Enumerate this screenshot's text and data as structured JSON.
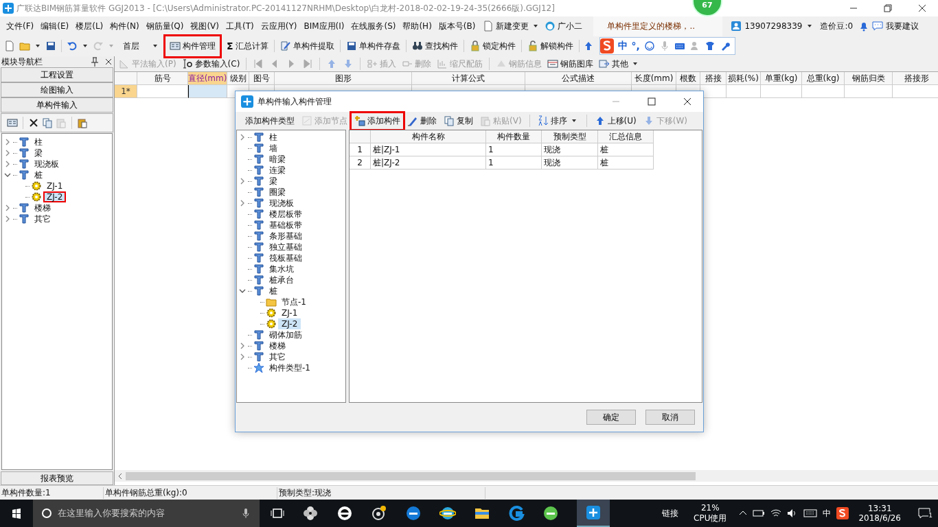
{
  "window": {
    "title": "广联达BIM钢筋算量软件 GGJ2013 - [C:\\Users\\Administrator.PC-20141127NRHM\\Desktop\\白龙村-2018-02-02-19-24-35(2666版).GGJ12]"
  },
  "floating_badge": "67",
  "menu": [
    "文件(F)",
    "编辑(E)",
    "楼层(L)",
    "构件(N)",
    "钢筋量(Q)",
    "视图(V)",
    "工具(T)",
    "云应用(Y)",
    "BIM应用(I)",
    "在线服务(S)",
    "帮助(H)",
    "版本号(B)"
  ],
  "menu_extras": [
    {
      "label": "新建变更",
      "kind": "dropdown"
    },
    {
      "label": "广小二",
      "kind": "plain"
    }
  ],
  "notice": "单构件里定义的楼梯，..",
  "account": {
    "user": "13907298339",
    "beans": "造价豆:0",
    "suggest": "我要建议"
  },
  "quick_buttons": [
    {
      "disabled": false
    },
    {
      "disabled": false
    },
    {
      "disabled": false
    },
    {
      "disabled": false
    },
    {
      "disabled": true
    }
  ],
  "floor": "首层",
  "toolbar": [
    {
      "label": "构件管理",
      "highlighted": true
    },
    {
      "label": "汇总计算",
      "glyph": "Σ"
    },
    {
      "label": "单构件提取"
    },
    {
      "label": "单构件存盘"
    },
    {
      "label": "查找构件"
    },
    {
      "label": "锁定构件"
    },
    {
      "label": "解锁构件"
    }
  ],
  "ime_bar": {
    "mode": "中",
    "punct": "°,"
  },
  "nav_panel": {
    "title": "模块导航栏",
    "modules": [
      "工程设置",
      "绘图输入",
      "单构件输入"
    ],
    "footer": "报表预览",
    "tree": [
      {
        "label": "柱",
        "kind": "category",
        "expanded": false,
        "selected": false
      },
      {
        "label": "梁",
        "kind": "category",
        "expanded": false,
        "selected": false
      },
      {
        "label": "现浇板",
        "kind": "category",
        "expanded": false,
        "selected": false
      },
      {
        "label": "桩",
        "kind": "category",
        "expanded": true,
        "selected": false,
        "children": [
          {
            "label": "ZJ-1",
            "kind": "component",
            "selected": false
          },
          {
            "label": "ZJ-2",
            "kind": "component",
            "selected": true,
            "highlighted": true
          }
        ]
      },
      {
        "label": "楼梯",
        "kind": "category",
        "expanded": false,
        "selected": false
      },
      {
        "label": "其它",
        "kind": "category",
        "expanded": false,
        "selected": false
      }
    ]
  },
  "grid_toolbar": [
    {
      "kind": "button",
      "label": "平法输入(P)",
      "disabled": true
    },
    {
      "kind": "button",
      "label": "参数输入(C)",
      "disabled": false
    },
    {
      "kind": "icon",
      "disabled": true
    },
    {
      "kind": "icon",
      "disabled": true
    },
    {
      "kind": "icon",
      "disabled": true
    },
    {
      "kind": "icon",
      "disabled": true
    },
    {
      "kind": "icon",
      "disabled": true
    },
    {
      "kind": "icon",
      "disabled": true
    },
    {
      "kind": "button",
      "label": "插入",
      "disabled": true
    },
    {
      "kind": "button",
      "label": "删除",
      "disabled": true
    },
    {
      "kind": "button",
      "label": "缩尺配筋",
      "disabled": true
    },
    {
      "kind": "button",
      "label": "钢筋信息",
      "disabled": true
    },
    {
      "kind": "button",
      "label": "钢筋图库",
      "disabled": false
    },
    {
      "kind": "dropdown",
      "label": "其他",
      "disabled": false
    }
  ],
  "grid": {
    "columns": [
      {
        "label": "筋号",
        "selected": false
      },
      {
        "label": "直径(mm)",
        "selected": true
      },
      {
        "label": "级别",
        "selected": false
      },
      {
        "label": "图号",
        "selected": false
      },
      {
        "label": "图形",
        "selected": false
      },
      {
        "label": "计算公式",
        "selected": false
      },
      {
        "label": "公式描述",
        "selected": false
      },
      {
        "label": "长度(mm)",
        "selected": false
      },
      {
        "label": "根数",
        "selected": false
      },
      {
        "label": "搭接",
        "selected": false
      },
      {
        "label": "损耗(%)",
        "selected": false
      },
      {
        "label": "单重(kg)",
        "selected": false
      },
      {
        "label": "总重(kg)",
        "selected": false
      },
      {
        "label": "钢筋归类",
        "selected": false
      },
      {
        "label": "搭接形",
        "selected": false
      }
    ],
    "rows": [
      {
        "header": "1*"
      }
    ]
  },
  "dialog": {
    "title": "单构件输入构件管理",
    "toolbar": [
      {
        "label": "添加构件类型",
        "disabled": false
      },
      {
        "label": "添加节点",
        "disabled": true
      },
      {
        "label": "添加构件",
        "disabled": false,
        "highlighted": true
      },
      {
        "label": "删除",
        "disabled": false
      },
      {
        "label": "复制",
        "disabled": false
      },
      {
        "label": "粘贴(V)",
        "disabled": true
      },
      {
        "label": "排序",
        "disabled": false,
        "kind": "dropdown"
      },
      {
        "label": "上移(U)",
        "disabled": false
      },
      {
        "label": "下移(W)",
        "disabled": true
      }
    ],
    "tree": [
      {
        "label": "柱",
        "kind": "category",
        "expanded": false,
        "selected": false
      },
      {
        "label": "墙",
        "kind": "category",
        "selected": false
      },
      {
        "label": "暗梁",
        "kind": "category",
        "selected": false
      },
      {
        "label": "连梁",
        "kind": "category",
        "selected": false
      },
      {
        "label": "梁",
        "kind": "category",
        "expanded": false,
        "selected": false
      },
      {
        "label": "圈梁",
        "kind": "category",
        "selected": false
      },
      {
        "label": "现浇板",
        "kind": "category",
        "expanded": false,
        "selected": false
      },
      {
        "label": "楼层板带",
        "kind": "category",
        "selected": false
      },
      {
        "label": "基础板带",
        "kind": "category",
        "selected": false
      },
      {
        "label": "条形基础",
        "kind": "category",
        "selected": false
      },
      {
        "label": "独立基础",
        "kind": "category",
        "selected": false
      },
      {
        "label": "筏板基础",
        "kind": "category",
        "selected": false
      },
      {
        "label": "集水坑",
        "kind": "category",
        "selected": false
      },
      {
        "label": "桩承台",
        "kind": "category",
        "selected": false
      },
      {
        "label": "桩",
        "kind": "category",
        "expanded": true,
        "selected": false,
        "children": [
          {
            "label": "节点-1",
            "kind": "folder",
            "selected": false
          },
          {
            "label": "ZJ-1",
            "kind": "component",
            "selected": false
          },
          {
            "label": "ZJ-2",
            "kind": "component",
            "selected": true
          }
        ]
      },
      {
        "label": "砌体加筋",
        "kind": "category",
        "selected": false
      },
      {
        "label": "楼梯",
        "kind": "category",
        "expanded": false,
        "selected": false
      },
      {
        "label": "其它",
        "kind": "category",
        "expanded": false,
        "selected": false
      },
      {
        "label": "构件类型-1",
        "kind": "custom",
        "selected": false
      }
    ],
    "table": {
      "columns": [
        "构件名称",
        "构件数量",
        "预制类型",
        "汇总信息"
      ],
      "rows": [
        {
          "index": "1",
          "cells": [
            "桩|ZJ-1",
            "1",
            "现浇",
            "桩"
          ]
        },
        {
          "index": "2",
          "cells": [
            "桩|ZJ-2",
            "1",
            "现浇",
            "桩"
          ]
        }
      ]
    },
    "buttons": [
      "确定",
      "取消"
    ]
  },
  "status_bar": [
    "单构件数量:1",
    "单构件钢筋总重(kg):0",
    "预制类型:现浇"
  ],
  "taskbar": {
    "search_placeholder": "在这里输入你要搜索的内容",
    "link": "链接",
    "cpu": "21%",
    "cpu_label": "CPU使用",
    "ime": "中",
    "time": "13:31",
    "date": "2018/6/26",
    "notifications": "1"
  }
}
